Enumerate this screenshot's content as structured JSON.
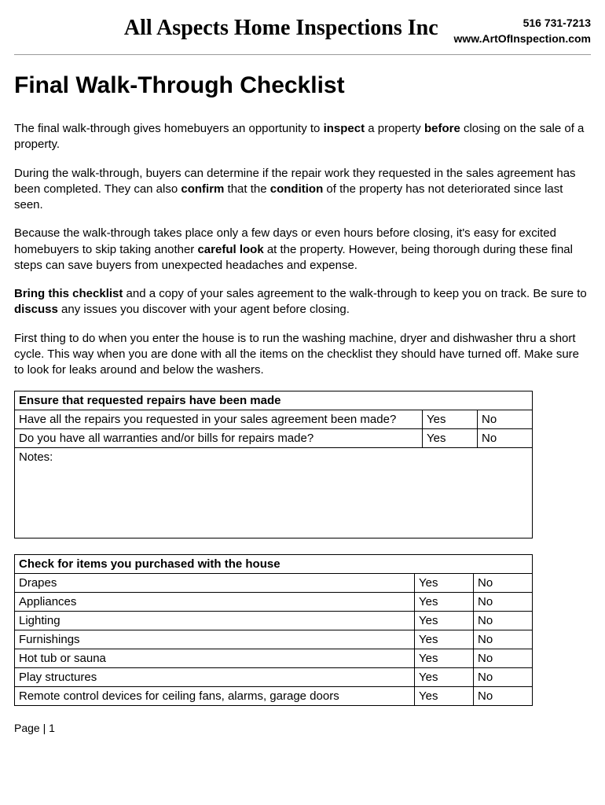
{
  "header": {
    "company": "All Aspects Home Inspections Inc",
    "phone": "516 731-7213",
    "website": "www.ArtOfInspection.com"
  },
  "title": "Final Walk-Through Checklist",
  "paragraphs": {
    "p1_a": "The final walk-through gives homebuyers an opportunity to ",
    "p1_b1": "inspect",
    "p1_c": " a property ",
    "p1_b2": "before",
    "p1_d": " closing on the sale of a property.",
    "p2_a": "During the walk-through, buyers can determine if the repair work they requested in the sales agreement has been completed. They can also ",
    "p2_b1": "confirm",
    "p2_c": " that the ",
    "p2_b2": "condition",
    "p2_d": " of the property has not deteriorated since last seen.",
    "p3_a": "Because the walk-through takes place only a few days or even hours before closing, it's easy for excited homebuyers to skip taking another ",
    "p3_b1": "careful look",
    "p3_c": " at the property. However, being thorough during these final steps can save buyers from unexpected headaches and expense.",
    "p4_b1": "Bring this checklist",
    "p4_a": " and a copy of your sales agreement to the walk-through to keep you on track. Be sure to ",
    "p4_b2": "discuss",
    "p4_c": " any issues you discover with your agent before closing.",
    "p5": "First thing to do when you enter the house is to run the washing machine, dryer and dishwasher thru a short cycle. This way when you are done with all the items on the checklist they should have turned off.  Make sure to look for leaks around and below the washers."
  },
  "table1": {
    "header": "Ensure that requested repairs have been made",
    "rows": [
      {
        "q": "Have all the repairs you requested in your sales agreement been made?",
        "yes": "Yes",
        "no": "No"
      },
      {
        "q": "Do you have all warranties and/or bills for repairs made?",
        "yes": "Yes",
        "no": "No"
      }
    ],
    "notes": "Notes:"
  },
  "table2": {
    "header": "Check for items you purchased with the house",
    "rows": [
      {
        "q": "Drapes",
        "yes": "Yes",
        "no": "No"
      },
      {
        "q": "Appliances",
        "yes": "Yes",
        "no": "No"
      },
      {
        "q": "Lighting",
        "yes": "Yes",
        "no": "No"
      },
      {
        "q": "Furnishings",
        "yes": "Yes",
        "no": "No"
      },
      {
        "q": "Hot tub or sauna",
        "yes": "Yes",
        "no": "No"
      },
      {
        "q": "Play structures",
        "yes": "Yes",
        "no": "No"
      },
      {
        "q": "Remote control devices for ceiling fans, alarms, garage doors",
        "yes": "Yes",
        "no": "No"
      }
    ]
  },
  "footer": "Page | 1"
}
